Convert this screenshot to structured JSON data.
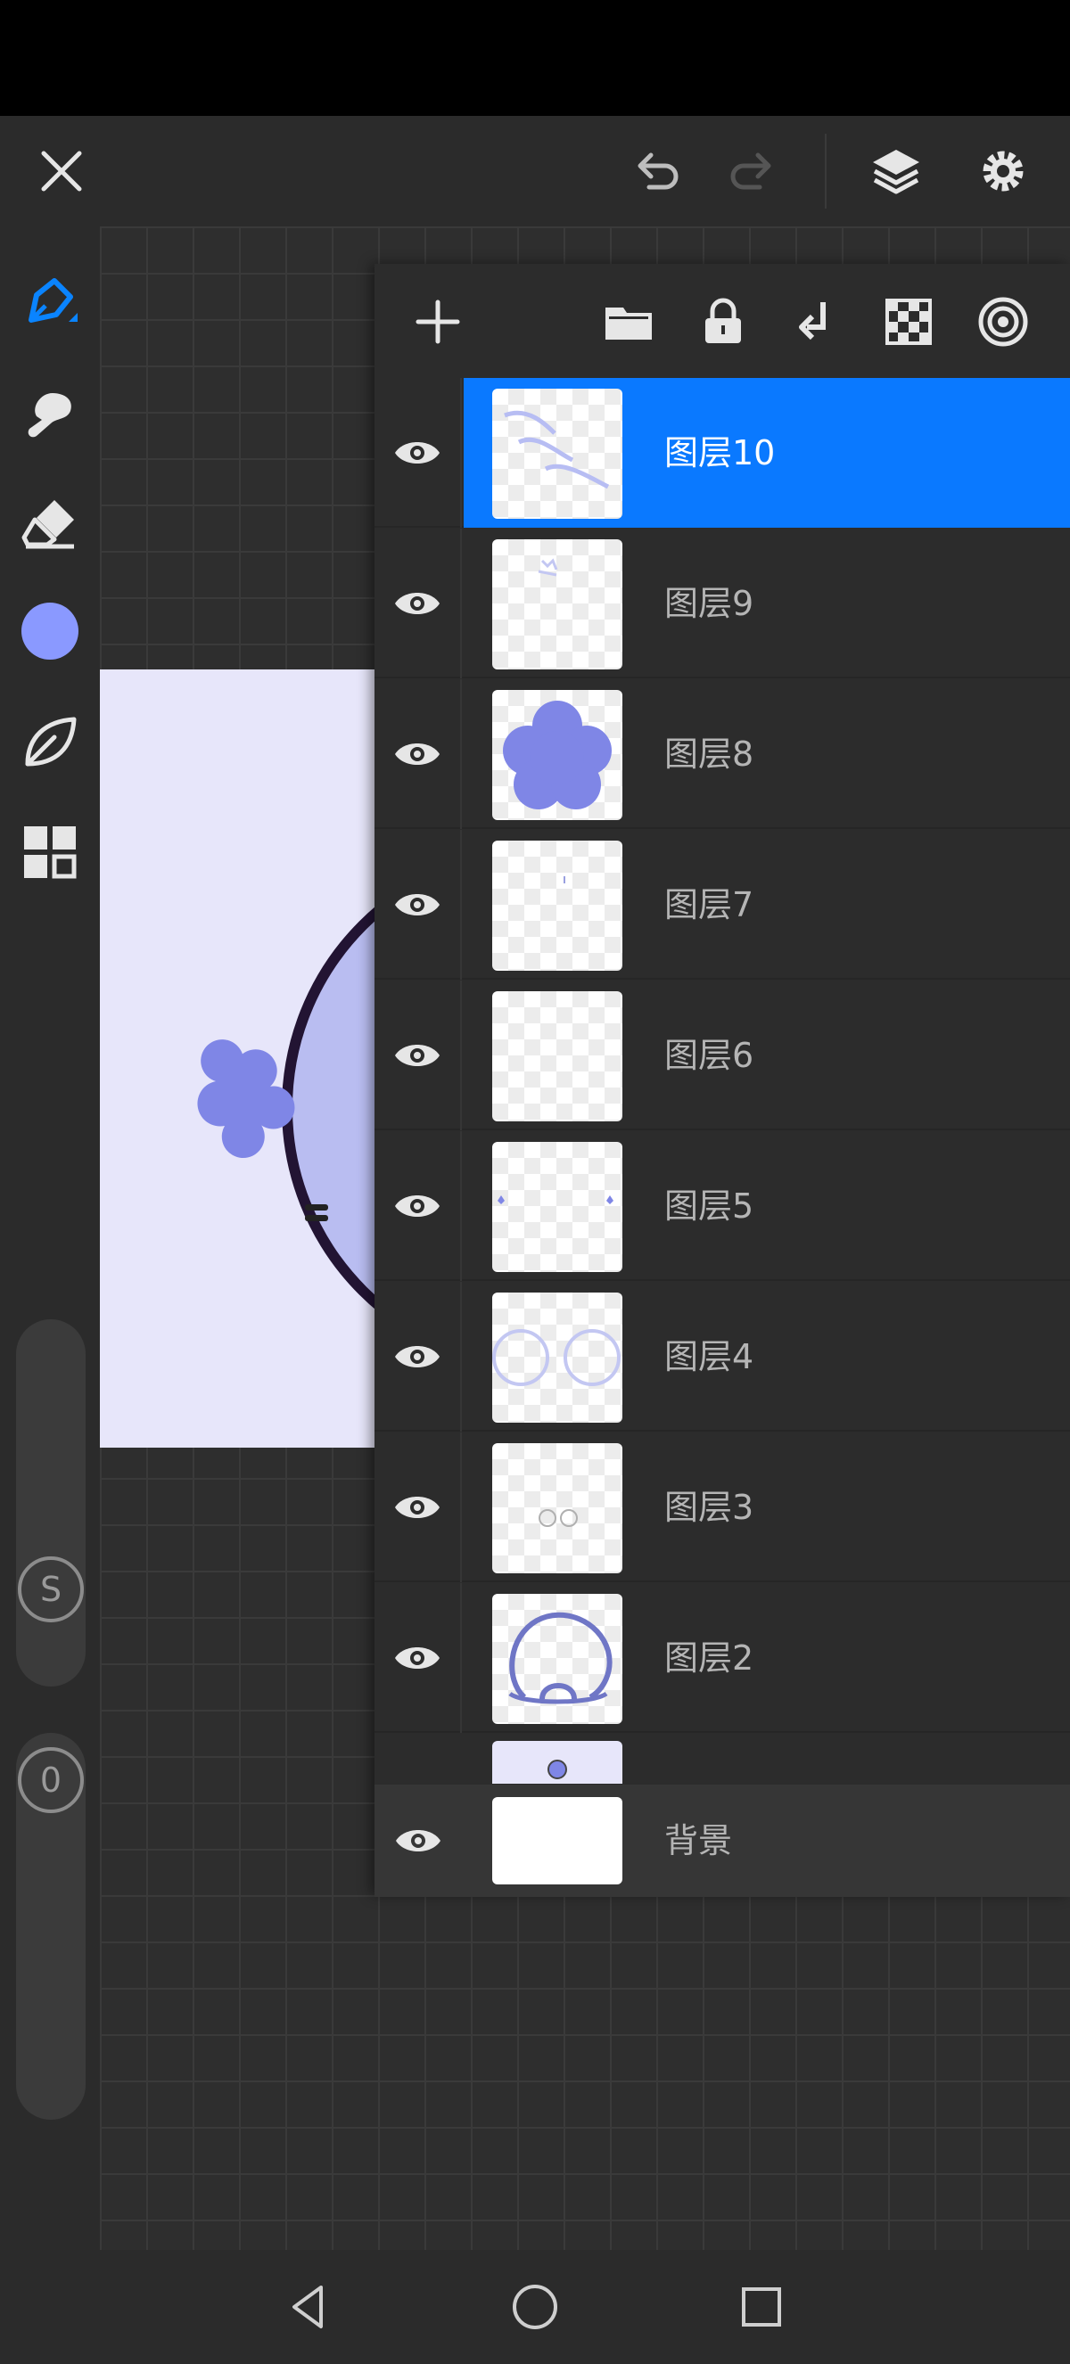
{
  "layers": [
    {
      "name": "图层10",
      "visible": true,
      "selected": true
    },
    {
      "name": "图层9",
      "visible": true,
      "selected": false
    },
    {
      "name": "图层8",
      "visible": true,
      "selected": false
    },
    {
      "name": "图层7",
      "visible": true,
      "selected": false
    },
    {
      "name": "图层6",
      "visible": true,
      "selected": false
    },
    {
      "name": "图层5",
      "visible": true,
      "selected": false
    },
    {
      "name": "图层4",
      "visible": true,
      "selected": false
    },
    {
      "name": "图层3",
      "visible": true,
      "selected": false
    },
    {
      "name": "图层2",
      "visible": true,
      "selected": false
    }
  ],
  "background_layer": {
    "name": "背景",
    "visible": true
  },
  "left_toolbar": {
    "brush_size_label": "S",
    "opacity_label": "0",
    "current_color": "#8a99ff"
  },
  "colors": {
    "accent": "#0a79ff",
    "canvas_background": "#e7e6fa",
    "artwork_purple": "#7f86e6"
  },
  "icons": {
    "top_bar": [
      "close-icon",
      "undo-icon",
      "redo-icon",
      "layers-icon",
      "settings-icon"
    ],
    "tools": [
      "pen-icon",
      "smudge-icon",
      "eraser-icon",
      "color-swatch",
      "leaf-icon",
      "grid-icon"
    ],
    "layer_actions": [
      "add-layer-icon",
      "folder-icon",
      "lock-icon",
      "merge-down-icon",
      "transparency-icon",
      "target-icon"
    ],
    "nav": [
      "back-nav-icon",
      "home-nav-icon",
      "recents-nav-icon"
    ]
  }
}
